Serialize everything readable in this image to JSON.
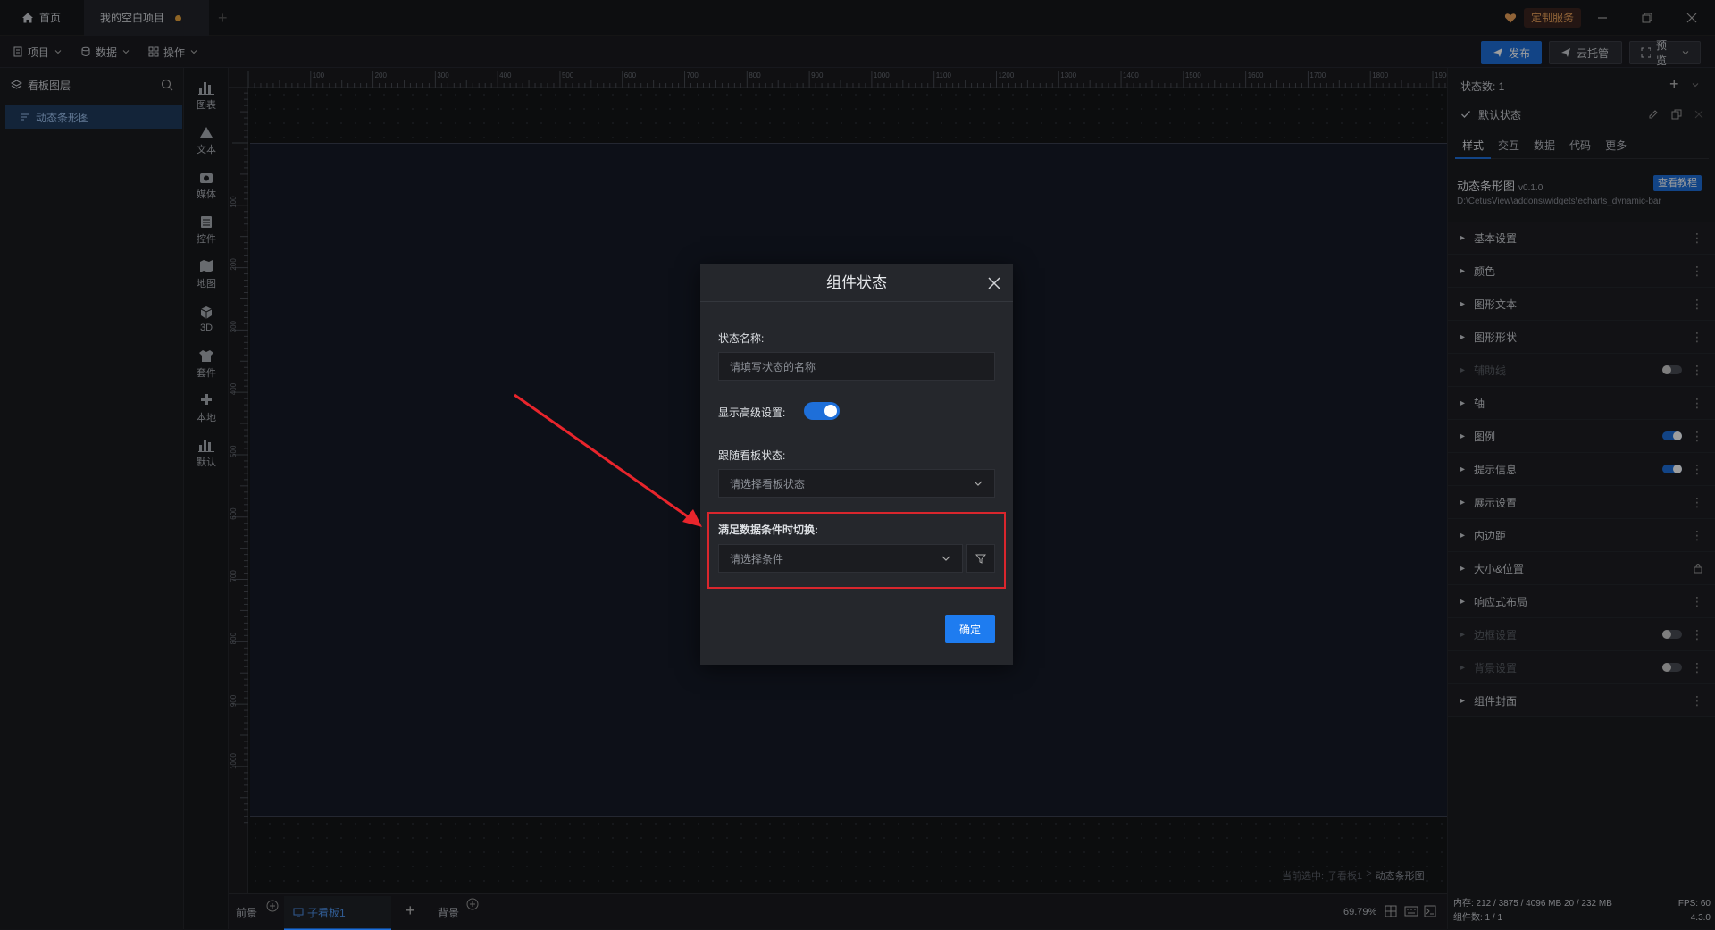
{
  "titlebar": {
    "tabs": [
      {
        "label": "首页"
      },
      {
        "label": "我的空白项目"
      }
    ],
    "custom_service": "定制服务"
  },
  "menubar": {
    "menus": [
      {
        "label": "项目"
      },
      {
        "label": "数据"
      },
      {
        "label": "操作"
      }
    ],
    "publish": "发布",
    "cloud": "云托管",
    "preview": "预览"
  },
  "layers": {
    "title": "看板图层",
    "items": [
      {
        "label": "动态条形图"
      }
    ]
  },
  "components": [
    {
      "label": "图表",
      "icon": "bar-chart-icon"
    },
    {
      "label": "文本",
      "icon": "text-icon"
    },
    {
      "label": "媒体",
      "icon": "media-icon"
    },
    {
      "label": "控件",
      "icon": "control-icon"
    },
    {
      "label": "地图",
      "icon": "map-icon"
    },
    {
      "label": "3D",
      "icon": "cube-icon"
    },
    {
      "label": "套件",
      "icon": "kit-icon"
    },
    {
      "label": "本地",
      "icon": "local-icon"
    },
    {
      "label": "默认",
      "icon": "default-icon"
    }
  ],
  "ruler": {
    "top": [
      "100",
      "200",
      "300",
      "400",
      "500",
      "600",
      "700",
      "800",
      "900",
      "1000",
      "1100",
      "1200",
      "1300",
      "1400",
      "1500",
      "1600",
      "1700",
      "1800",
      "1900"
    ],
    "left": [
      "100",
      "200",
      "300",
      "400",
      "500",
      "600",
      "700",
      "800",
      "900",
      "1000"
    ]
  },
  "canvas": {
    "selection_prefix": "当前选中:",
    "selection_board": "子看板1",
    "selection_sep": ">",
    "selection_item": "动态条形图"
  },
  "bottombar": {
    "tabs": [
      {
        "label": "前景"
      },
      {
        "label": "子看板1"
      },
      {
        "label": "背景"
      }
    ],
    "zoom": "69.79%"
  },
  "right_panel": {
    "state_count": "状态数: 1",
    "default_state": "默认状态",
    "tabs": [
      {
        "label": "样式"
      },
      {
        "label": "交互"
      },
      {
        "label": "数据"
      },
      {
        "label": "代码"
      },
      {
        "label": "更多"
      }
    ],
    "widget_name": "动态条形图",
    "widget_version": "v0.1.0",
    "tutorial": "查看教程",
    "widget_path": "D:\\CetusView\\addons\\widgets\\echarts_dynamic-bar",
    "sections": [
      {
        "label": "基本设置"
      },
      {
        "label": "颜色"
      },
      {
        "label": "图形文本"
      },
      {
        "label": "图形形状"
      },
      {
        "label": "辅助线"
      },
      {
        "label": "轴"
      },
      {
        "label": "图例"
      },
      {
        "label": "提示信息"
      },
      {
        "label": "展示设置"
      },
      {
        "label": "内边距"
      },
      {
        "label": "大小&位置"
      },
      {
        "label": "响应式布局"
      },
      {
        "label": "边框设置"
      },
      {
        "label": "背景设置"
      },
      {
        "label": "组件封面"
      }
    ],
    "status_line1": "内存: 212 / 3875 / 4096 MB  20 / 232 MB",
    "fps": "FPS: 60",
    "status_line2": "组件数: 1 / 1",
    "version": "4.3.0"
  },
  "dialog": {
    "title": "组件状态",
    "name_label": "状态名称:",
    "name_placeholder": "请填写状态的名称",
    "advanced_label": "显示高级设置:",
    "advanced_on": true,
    "follow_label": "跟随看板状态:",
    "follow_placeholder": "请选择看板状态",
    "condition_label": "满足数据条件时切换:",
    "condition_placeholder": "请选择条件",
    "confirm": "确定"
  },
  "colors": {
    "accent": "#1e6fd9",
    "highlight": "#d9262d",
    "arrow": "#e8252c"
  }
}
